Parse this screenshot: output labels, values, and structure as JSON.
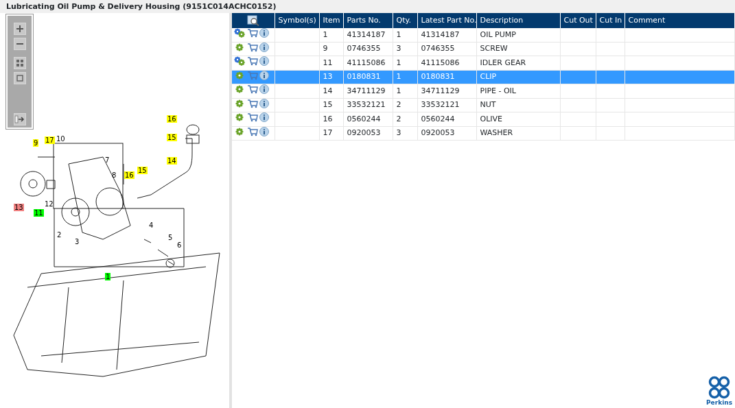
{
  "window": {
    "title": "Lubricating Oil Pump & Delivery Housing (9151C014ACHC0152)"
  },
  "callouts": [
    {
      "label": "16",
      "color": "#ffff00"
    },
    {
      "label": "15",
      "color": "#ffff00"
    },
    {
      "label": "14",
      "color": "#ffff00"
    },
    {
      "label": "9",
      "color": "#ffff00"
    },
    {
      "label": "17",
      "color": "#ffff00"
    },
    {
      "label": "10"
    },
    {
      "label": "7"
    },
    {
      "label": "8"
    },
    {
      "label": "16",
      "color": "#ffff00"
    },
    {
      "label": "15",
      "color": "#ffff00"
    },
    {
      "label": "13",
      "color": "#f08080"
    },
    {
      "label": "11",
      "color": "#00ff00"
    },
    {
      "label": "12"
    },
    {
      "label": "2"
    },
    {
      "label": "3"
    },
    {
      "label": "4"
    },
    {
      "label": "5"
    },
    {
      "label": "6"
    },
    {
      "label": "1",
      "color": "#00ff00"
    }
  ],
  "table": {
    "columns": [
      "Symbol(s)",
      "Item",
      "Parts No.",
      "Qty.",
      "Latest Part No.",
      "Description",
      "Cut Out",
      "Cut In",
      "Comment"
    ],
    "rows": [
      {
        "kind": "assembly",
        "selected": false,
        "cells": [
          "",
          "1",
          "41314187",
          "1",
          "41314187",
          "OIL PUMP",
          "",
          "",
          ""
        ]
      },
      {
        "kind": "part",
        "selected": false,
        "cells": [
          "",
          "9",
          "0746355",
          "3",
          "0746355",
          "SCREW",
          "",
          "",
          ""
        ]
      },
      {
        "kind": "assembly",
        "selected": false,
        "cells": [
          "",
          "11",
          "41115086",
          "1",
          "41115086",
          "IDLER GEAR",
          "",
          "",
          ""
        ]
      },
      {
        "kind": "part",
        "selected": true,
        "cells": [
          "",
          "13",
          "0180831",
          "1",
          "0180831",
          "CLIP",
          "",
          "",
          ""
        ]
      },
      {
        "kind": "part",
        "selected": false,
        "cells": [
          "",
          "14",
          "34711129",
          "1",
          "34711129",
          "PIPE - OIL",
          "",
          "",
          ""
        ]
      },
      {
        "kind": "part",
        "selected": false,
        "cells": [
          "",
          "15",
          "33532121",
          "2",
          "33532121",
          "NUT",
          "",
          "",
          ""
        ]
      },
      {
        "kind": "part",
        "selected": false,
        "cells": [
          "",
          "16",
          "0560244",
          "2",
          "0560244",
          "OLIVE",
          "",
          "",
          ""
        ]
      },
      {
        "kind": "part",
        "selected": false,
        "cells": [
          "",
          "17",
          "0920053",
          "3",
          "0920053",
          "WASHER",
          "",
          "",
          ""
        ]
      }
    ]
  },
  "logo": {
    "text": "Perkins"
  }
}
